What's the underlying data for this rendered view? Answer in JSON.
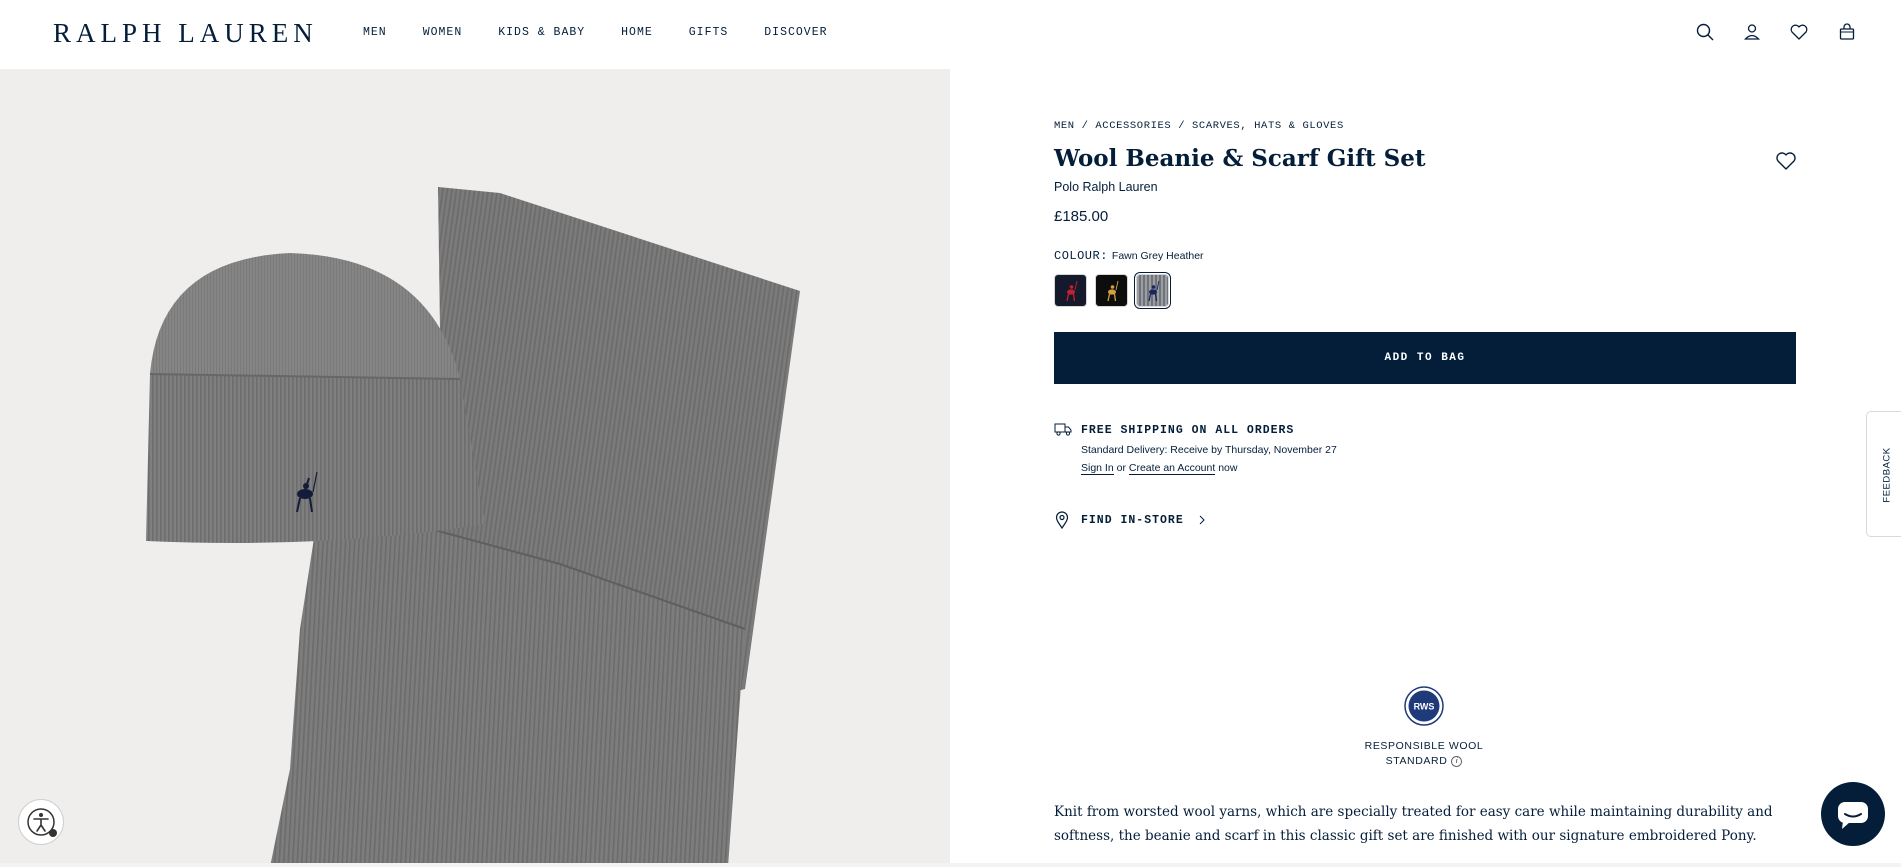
{
  "header": {
    "logo": "RALPH LAUREN",
    "nav": [
      "MEN",
      "WOMEN",
      "KIDS & BABY",
      "HOME",
      "GIFTS",
      "DISCOVER"
    ],
    "icons": [
      "search-icon",
      "account-icon",
      "wishlist-icon",
      "bag-icon"
    ]
  },
  "product": {
    "breadcrumb": [
      "MEN",
      "ACCESSORIES",
      "SCARVES, HATS & GLOVES"
    ],
    "breadcrumb_sep": " / ",
    "title": "Wool Beanie & Scarf Gift Set",
    "brand": "Polo Ralph Lauren",
    "price": "£185.00",
    "colour_label": "COLOUR:",
    "colour_value": "Fawn Grey Heather",
    "swatches": [
      {
        "bg": "#141a2c",
        "pony": "#c4202f"
      },
      {
        "bg": "#0d0d0d",
        "pony": "#d4a040"
      },
      {
        "bg": "#8a8d92",
        "pony": "#1b2660"
      }
    ],
    "add_to_bag": "ADD TO BAG"
  },
  "shipping": {
    "title": "FREE SHIPPING ON ALL ORDERS",
    "delivery": "Standard Delivery: Receive by Thursday, November 27",
    "sign_in": "Sign In",
    "or": "or",
    "create_account": "Create an Account",
    "now": "now",
    "find_store": "FIND IN-STORE"
  },
  "sustainability": {
    "badge_text": "RWS",
    "line1": "RESPONSIBLE WOOL",
    "line2": "STANDARD",
    "info": "i"
  },
  "description": "Knit from worsted wool yarns, which are specially treated for easy care while maintaining durability and softness, the beanie and scarf in this classic gift set are finished with our signature embroidered Pony.",
  "feedback": "FEEDBACK",
  "colors": {
    "navy": "#041e3a",
    "image_bg": "#efeeec",
    "knit_grey": "#7e7e7e"
  }
}
